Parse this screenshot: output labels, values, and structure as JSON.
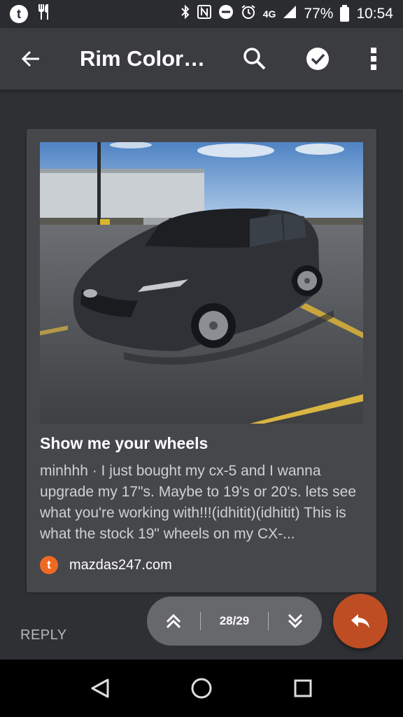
{
  "status_bar": {
    "network": "4G",
    "battery": "77%",
    "time": "10:54"
  },
  "app_bar": {
    "title": "Rim Colors,..."
  },
  "post": {
    "title": "Show me your wheels",
    "excerpt": "minhhh · I just bought my cx-5 and I wanna upgrade my 17\"s. Maybe to 19's or 20's. lets see what you're working with!!!(idhitit)(idhitit) This is what the stock 19\" wheels on my CX-...",
    "source_icon_letter": "t",
    "source": "mazdas247.com"
  },
  "bottom": {
    "reply_label": "REPLY",
    "pager_count": "28/29"
  },
  "colors": {
    "accent": "#bf4d23",
    "source_badge": "#ee6a22",
    "card_bg": "#46474b",
    "page_bg": "#2f3034"
  }
}
